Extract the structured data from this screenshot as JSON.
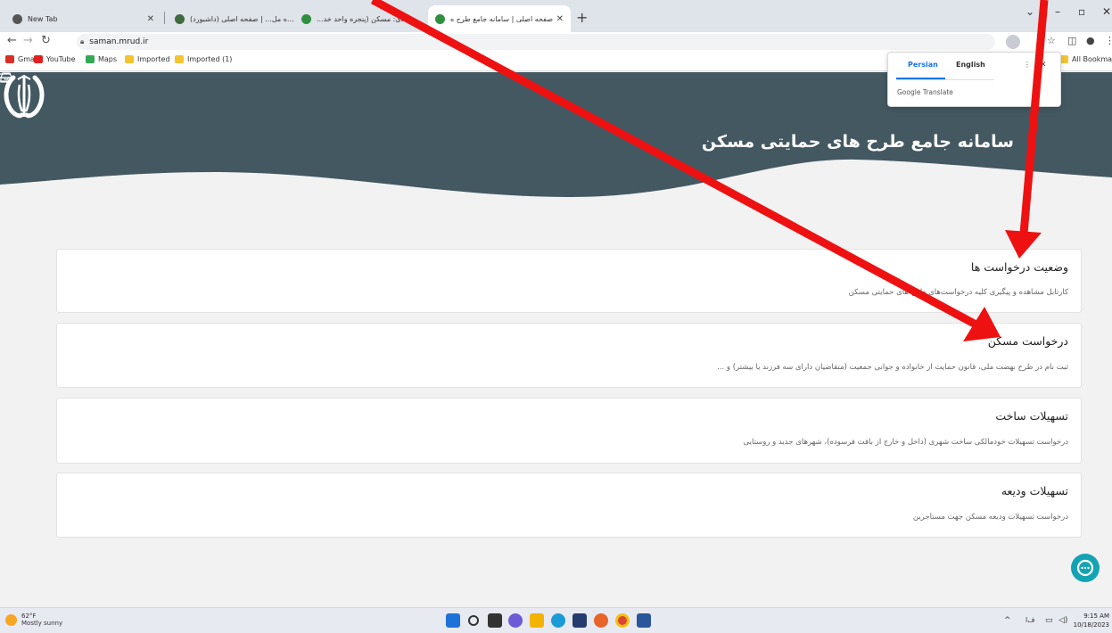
{
  "browser": {
    "tabs": [
      {
        "title": "New Tab",
        "favicon": "chrome-icon",
        "active": false
      },
      {
        "title": "پنجره مل... | صفحه اصلی (داشبورد)",
        "favicon": "emblem-icon",
        "active": false
      },
      {
        "title": "...صفحه بندی: مسکن (پنجره واحد خد",
        "favicon": "emblem-icon",
        "active": false
      },
      {
        "title": "صفحه اصلی | سامانه جامع طرح ه",
        "favicon": "emblem-icon",
        "active": true
      }
    ],
    "url": "saman.mrud.ir",
    "bookmarks": [
      {
        "label": "Gmail",
        "icon": "gmail-icon",
        "color": "#d93025"
      },
      {
        "label": "YouTube",
        "icon": "youtube-icon",
        "color": "#e02020"
      },
      {
        "label": "Maps",
        "icon": "maps-icon",
        "color": "#34a853"
      },
      {
        "label": "Imported",
        "icon": "folder-icon",
        "color": "#f4c430"
      },
      {
        "label": "Imported (1)",
        "icon": "folder-icon",
        "color": "#f4c430"
      }
    ],
    "all_bookmarks_label": "All Bookmarks"
  },
  "translate_popup": {
    "tab_active": "Persian",
    "tab_other": "English",
    "brand": "Google Translate"
  },
  "header": {
    "title": "سامانه جامع طرح های حمایتی مسکن",
    "bg_color": "#445862"
  },
  "cards": [
    {
      "title": "وضعیت درخواست ها",
      "desc": "کارتابل مشاهده و پیگیری کلیه درخواست‌های طرح های حمایتی مسکن"
    },
    {
      "title": "درخواست مسکن",
      "desc": "ثبت نام در طرح نهضت ملی، قانون حمایت از خانواده و جوانی جمعیت (متقاضیان دارای سه فرزند یا بیشتر) و ..."
    },
    {
      "title": "تسهیلات ساخت",
      "desc": "درخواست تسهیلات خودمالکی ساخت شهری (داخل و خارج از بافت فرسوده)، شهرهای جدید و روستایی"
    },
    {
      "title": "تسهیلات ودیعه",
      "desc": "درخواست تسهیلات ودیعه مسکن جهت مستاجرین"
    }
  ],
  "annotation_color": "#ee1111",
  "taskbar": {
    "temperature": "62°F",
    "condition": "Mostly sunny",
    "time": "9:15 AM",
    "date": "10/18/2023",
    "lang": "ﻑﺍ"
  }
}
